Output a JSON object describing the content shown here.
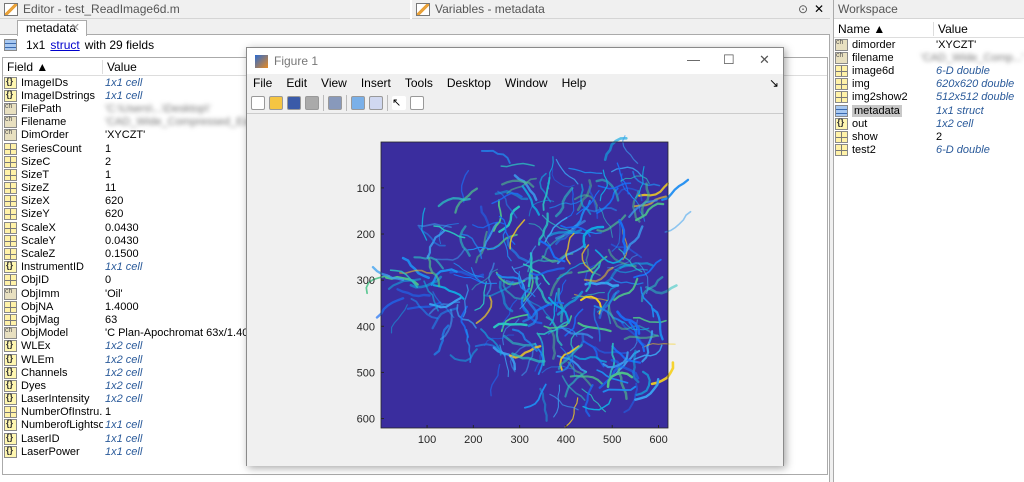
{
  "editor": {
    "title": "Editor - test_ReadImage6d.m",
    "tab": "metadata",
    "close": "✕"
  },
  "variables": {
    "title": "Variables - metadata",
    "menu_icon": "⊙",
    "close": "✕"
  },
  "summary": {
    "prefix": "1x1",
    "link": "struct",
    "suffix": "with 29 fields"
  },
  "table": {
    "headers": [
      "Field ▲",
      "Value"
    ],
    "rows": [
      {
        "icon": "cell",
        "field": "ImageIDs",
        "value": "1x1 cell"
      },
      {
        "icon": "cell",
        "field": "ImageIDstrings",
        "value": "1x1 cell"
      },
      {
        "icon": "char",
        "field": "FilePath",
        "value": "'C:\\Users\\...\\Desktop\\'",
        "blur": true
      },
      {
        "icon": "char",
        "field": "Filename",
        "value": "'CAD_Wide_Compressed_Experiment...'",
        "blur": true
      },
      {
        "icon": "char",
        "field": "DimOrder",
        "value": "'XYCZT'"
      },
      {
        "icon": "num",
        "field": "SeriesCount",
        "value": "1"
      },
      {
        "icon": "num",
        "field": "SizeC",
        "value": "2"
      },
      {
        "icon": "num",
        "field": "SizeT",
        "value": "1"
      },
      {
        "icon": "num",
        "field": "SizeZ",
        "value": "11"
      },
      {
        "icon": "num",
        "field": "SizeX",
        "value": "620"
      },
      {
        "icon": "num",
        "field": "SizeY",
        "value": "620"
      },
      {
        "icon": "num",
        "field": "ScaleX",
        "value": "0.0430"
      },
      {
        "icon": "num",
        "field": "ScaleY",
        "value": "0.0430"
      },
      {
        "icon": "num",
        "field": "ScaleZ",
        "value": "0.1500"
      },
      {
        "icon": "cell",
        "field": "InstrumentID",
        "value": "1x1 cell"
      },
      {
        "icon": "num",
        "field": "ObjID",
        "value": "0"
      },
      {
        "icon": "char",
        "field": "ObjImm",
        "value": "'Oil'"
      },
      {
        "icon": "num",
        "field": "ObjNA",
        "value": "1.4000"
      },
      {
        "icon": "num",
        "field": "ObjMag",
        "value": "63"
      },
      {
        "icon": "char",
        "field": "ObjModel",
        "value": "'C Plan-Apochromat 63x/1.40'"
      },
      {
        "icon": "cell",
        "field": "WLEx",
        "value": "1x2 cell"
      },
      {
        "icon": "cell",
        "field": "WLEm",
        "value": "1x2 cell"
      },
      {
        "icon": "cell",
        "field": "Channels",
        "value": "1x2 cell"
      },
      {
        "icon": "cell",
        "field": "Dyes",
        "value": "1x2 cell"
      },
      {
        "icon": "cell",
        "field": "LaserIntensity",
        "value": "1x2 cell"
      },
      {
        "icon": "num",
        "field": "NumberOfInstru...",
        "value": "1"
      },
      {
        "icon": "cell",
        "field": "NumberofLightso...",
        "value": "1x1 cell"
      },
      {
        "icon": "cell",
        "field": "LaserID",
        "value": "1x1 cell"
      },
      {
        "icon": "cell",
        "field": "LaserPower",
        "value": "1x1 cell"
      }
    ]
  },
  "workspace": {
    "title": "Workspace",
    "headers": [
      "Name ▲",
      "Value"
    ],
    "rows": [
      {
        "icon": "char",
        "name": "dimorder",
        "value": "'XYCZT'"
      },
      {
        "icon": "char",
        "name": "filename",
        "value": "'CAD_Wide_Comp...'",
        "blur": true
      },
      {
        "icon": "num",
        "name": "image6d",
        "value": "6-D double",
        "italic": true
      },
      {
        "icon": "num",
        "name": "img",
        "value": "620x620 double",
        "italic": true
      },
      {
        "icon": "num",
        "name": "img2show2",
        "value": "512x512 double",
        "italic": true
      },
      {
        "icon": "struct",
        "name": "metadata",
        "value": "1x1 struct",
        "italic": true,
        "selected": true
      },
      {
        "icon": "cell",
        "name": "out",
        "value": "1x2 cell",
        "italic": true
      },
      {
        "icon": "num",
        "name": "show",
        "value": "2"
      },
      {
        "icon": "num",
        "name": "test2",
        "value": "6-D double",
        "italic": true
      }
    ]
  },
  "figure": {
    "title": "Figure 1",
    "min": "—",
    "max": "☐",
    "close": "✕",
    "dock": "↘",
    "menu": [
      "File",
      "Edit",
      "View",
      "Insert",
      "Tools",
      "Desktop",
      "Window",
      "Help"
    ],
    "toolbar": [
      "new-figure",
      "open-file",
      "save",
      "print",
      "print-preview",
      "colorbar",
      "legend",
      "pointer",
      "property-editor"
    ]
  },
  "chart_data": {
    "type": "heatmap",
    "title": "",
    "xlabel": "",
    "ylabel": "",
    "xlim": [
      0.5,
      620.5
    ],
    "ylim": [
      0.5,
      620.5
    ],
    "y_reversed": true,
    "xticks": [
      100,
      200,
      300,
      400,
      500,
      600
    ],
    "yticks": [
      100,
      200,
      300,
      400,
      500,
      600
    ],
    "colormap": "parula",
    "background_color": "#3a2d9e"
  }
}
